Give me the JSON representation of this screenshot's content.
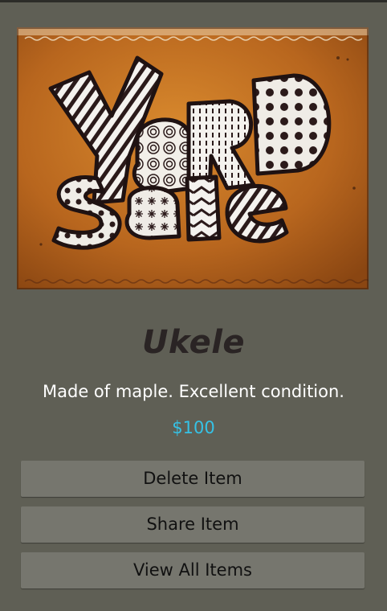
{
  "item": {
    "title": "Ukele",
    "description": "Made of maple. Excellent condition.",
    "price": "$100",
    "photo_sign_text": "Yard Sale"
  },
  "actions": {
    "delete_label": "Delete Item",
    "share_label": "Share Item",
    "view_all_label": "View All Items"
  },
  "colors": {
    "background": "#5f5f55",
    "title": "#2a2424",
    "price": "#35c2e6",
    "button": "#76766e",
    "cardboard": "#b8661e"
  }
}
